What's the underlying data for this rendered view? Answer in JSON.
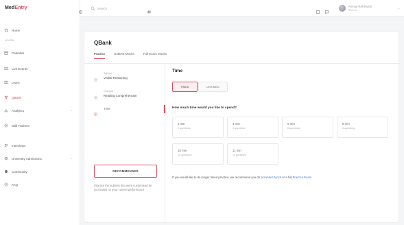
{
  "app": {
    "logo_main": "Med",
    "logo_accent": "Entry"
  },
  "search": {
    "placeholder": "Search"
  },
  "user": {
    "name": "Ahmad Rafi Rusdi",
    "sub": "Student"
  },
  "sidebar": {
    "section_label": "LEARN",
    "items": [
      {
        "label": "Home",
        "icon": "home-icon"
      },
      {
        "label": "Calendar",
        "icon": "calendar-icon"
      },
      {
        "label": "Live Events",
        "icon": "live-icon"
      },
      {
        "label": "Learn",
        "icon": "book-icon"
      },
      {
        "label": "QBank",
        "icon": "qbank-icon"
      },
      {
        "label": "Analytics",
        "icon": "chart-icon"
      },
      {
        "label": "Skill Trainers",
        "icon": "target-icon"
      },
      {
        "label": "Interviews",
        "icon": "interview-icon"
      },
      {
        "label": "University Admissions",
        "icon": "cap-icon"
      },
      {
        "label": "Community",
        "icon": "community-icon"
      },
      {
        "label": "FAQ",
        "icon": "faq-icon"
      }
    ]
  },
  "main": {
    "title": "QBank",
    "tabs": [
      "Practice",
      "Subtest Mocks",
      "Full Exam Mocks"
    ],
    "steps": [
      {
        "label": "Subtest",
        "value": "Verbal Reasoning"
      },
      {
        "label": "Category",
        "value": "Reading Comprehension"
      },
      {
        "label": "Time",
        "value": ""
      }
    ],
    "recommended_label": "RECOMMENDED",
    "recommended_desc": "Practice the subsets that were customised for you based on your current performance",
    "content_title": "Time",
    "toggle_timed": "TIMED",
    "toggle_untimed": "UNTIMED",
    "question": "How much time would you like to spend?",
    "options": [
      {
        "time": "2 min",
        "questions": "2 questions"
      },
      {
        "time": "4 min",
        "questions": "4 questions"
      },
      {
        "time": "6 min",
        "questions": "6 questions"
      },
      {
        "time": "8 min",
        "questions": "8 questions"
      },
      {
        "time": "10 min",
        "questions": "10 questions"
      },
      {
        "time": "11 min",
        "questions": "11 questions"
      }
    ],
    "note_text": "If you would like to do longer timed practice, we recommend you do a ",
    "note_link1": "Subtest Mock",
    "note_mid": " or a full ",
    "note_link2": "Practice Exam"
  },
  "colors": {
    "accent": "#e24c5a",
    "link": "#3b82d4"
  }
}
